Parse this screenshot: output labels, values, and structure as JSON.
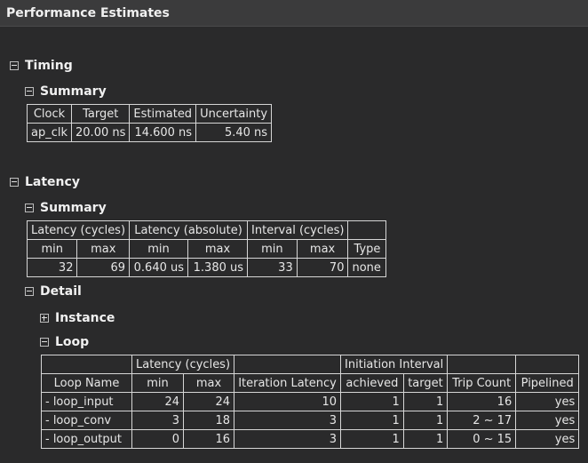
{
  "window": {
    "title": "Performance Estimates"
  },
  "timing": {
    "heading": "Timing",
    "summary_heading": "Summary",
    "columns": [
      "Clock",
      "Target",
      "Estimated",
      "Uncertainty"
    ],
    "row": [
      "ap_clk",
      "20.00 ns",
      "14.600 ns",
      "5.40 ns"
    ]
  },
  "latency": {
    "heading": "Latency",
    "summary_heading": "Summary",
    "group_headers": [
      "Latency (cycles)",
      "Latency (absolute)",
      "Interval (cycles)"
    ],
    "sub_headers": [
      "min",
      "max",
      "min",
      "max",
      "min",
      "max",
      "Type"
    ],
    "row": [
      "32",
      "69",
      "0.640 us",
      "1.380 us",
      "33",
      "70",
      "none"
    ],
    "detail_heading": "Detail",
    "instance_heading": "Instance",
    "loop_heading": "Loop",
    "loop": {
      "group_headers": [
        "Latency (cycles)",
        "Initiation Interval"
      ],
      "columns": [
        "Loop Name",
        "min",
        "max",
        "Iteration Latency",
        "achieved",
        "target",
        "Trip Count",
        "Pipelined"
      ],
      "rows": [
        [
          "- loop_input",
          "24",
          "24",
          "10",
          "1",
          "1",
          "16",
          "yes"
        ],
        [
          "- loop_conv",
          "3",
          "18",
          "3",
          "1",
          "1",
          "2 ~ 17",
          "yes"
        ],
        [
          "- loop_output",
          "0",
          "16",
          "3",
          "1",
          "1",
          "0 ~ 15",
          "yes"
        ]
      ]
    }
  }
}
